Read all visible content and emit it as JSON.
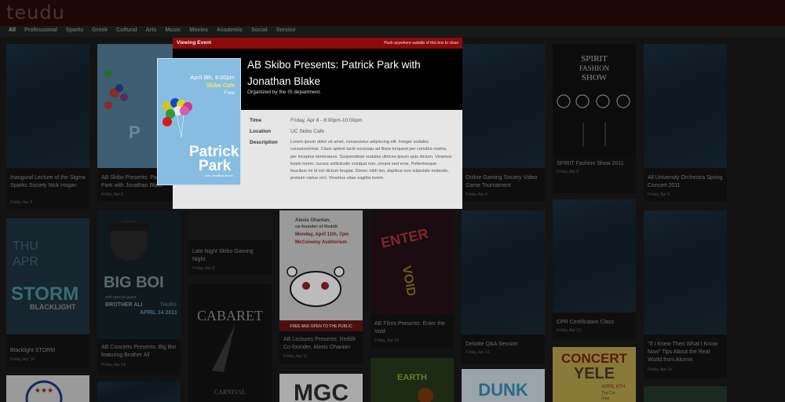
{
  "app": {
    "logo": "teudu"
  },
  "categories": [
    "All",
    "Professional",
    "Sports",
    "Greek",
    "Cultural",
    "Arts",
    "Music",
    "Movies",
    "Academic",
    "Social",
    "Service"
  ],
  "tiles": [
    {
      "title": "Inaugural Lecture of the Sigma Sparks Society Nick Hogan",
      "date": "Friday, Apr 8"
    },
    {
      "title": "AB Skibo Presents: Patrick Park with Jonathan Blake",
      "date": "Friday, Apr 8"
    },
    {
      "title": "Late Night Skibo Gaming Night",
      "date": "Friday, Apr 8"
    },
    {
      "title": "Online Gaming Society Video Game Tournament",
      "date": "Friday, Apr 8"
    },
    {
      "title": "SPIRIT Fashion Show 2011",
      "date": "Friday, Apr 9"
    },
    {
      "title": "All University Orchestra Spring Concert 2011",
      "date": "Friday, Apr 9"
    },
    {
      "title": "Blacklight STORM",
      "date": "Friday, Apr 14"
    },
    {
      "title": "AB Concerts Presents: Big Boi featuring Brother Ali",
      "date": "Friday, Apr 14"
    },
    {
      "title": "AB Lectures Presents: Reddit Co-founder, Alexis Ohanian",
      "date": "Friday, Apr 11"
    },
    {
      "title": "AB Films Presents: Enter the Void",
      "date": "Friday, Apr 10"
    },
    {
      "title": "Deloitte Q&A Session",
      "date": "Friday, Apr 12"
    },
    {
      "title": "CPR Certification Class",
      "date": "Friday, Apr 13"
    },
    {
      "title": "\"If I Knew Then What I Know Now\" Tips About the Real World from Alumni",
      "date": "Friday, Apr 14"
    }
  ],
  "posters": {
    "spirit": {
      "line1": "SPIRIT",
      "line2": "FASHION",
      "line3": "SHOW"
    },
    "storm": {
      "line1": "THU",
      "line2": "APR",
      "line3": "STORM",
      "line4": "BLACKLIGHT"
    },
    "bigboi": {
      "name": "BIG BOI",
      "guest": "with special guest",
      "guest2": "BROTHER ALI",
      "day": "THURS",
      "date": "APRIL 14 2011"
    },
    "reddit": {
      "line1": "Alexis Ohanian,",
      "line2": "co-founder of Reddit",
      "line3": "Monday, April 11th, 7pm",
      "line4": "McConomy Auditorium",
      "footer": "FREE AND OPEN TO THE PUBLIC"
    },
    "enter": {
      "line1": "ENTER",
      "line2": "VOID"
    },
    "cabaret": {
      "line1": "CABARET",
      "line2": "CARNIVAL"
    },
    "concert": {
      "line1": "CONCERT",
      "line2": "YELE",
      "line3": "APRIL 8TH",
      "line4": "The Cut",
      "line5": "Free"
    },
    "mgc": {
      "text": "MGC"
    },
    "dunk": {
      "text": "DUNK"
    },
    "earth": {
      "text": "EARTH"
    }
  },
  "modal": {
    "header_label": "Viewing Event",
    "close_hint": "Push anywhere outside of this box to close",
    "title": "AB Skibo Presents: Patrick Park with Jonathan Blake",
    "organizer": "Organized by the IS department.",
    "time_label": "Time",
    "time_value": "Friday, Apr 8 - 8:00pm-10:00pm",
    "location_label": "Location",
    "location_value": "UC Skibo Cafe",
    "description_label": "Description",
    "description_value": "Lorem ipsum dolor sit amet, consectetur adipiscing elit. Integer sodales cursusvolvinar. Class aptent taciti sociosqu ad litora torquent per conubia nostra, per inceptos himenaeos. Suspendisse sodales ultrices ipsum quis dictum. Vivamus turpis lorem, cursus sollicitudin volutpat non, ornare sed eros. Pellentesque faucibus mi id est dictum feugiat. Donec nibh leo, dapibus non vulputate molestie, pretium varius orci. Vivamus vitae sagittis lorem.",
    "poster": {
      "date": "April 8th, 8:00pm",
      "venue": "Skibo Cafe",
      "price": "Free",
      "name1": "Patrick",
      "name2": "Park",
      "with": "with Jonathan Blake"
    }
  }
}
